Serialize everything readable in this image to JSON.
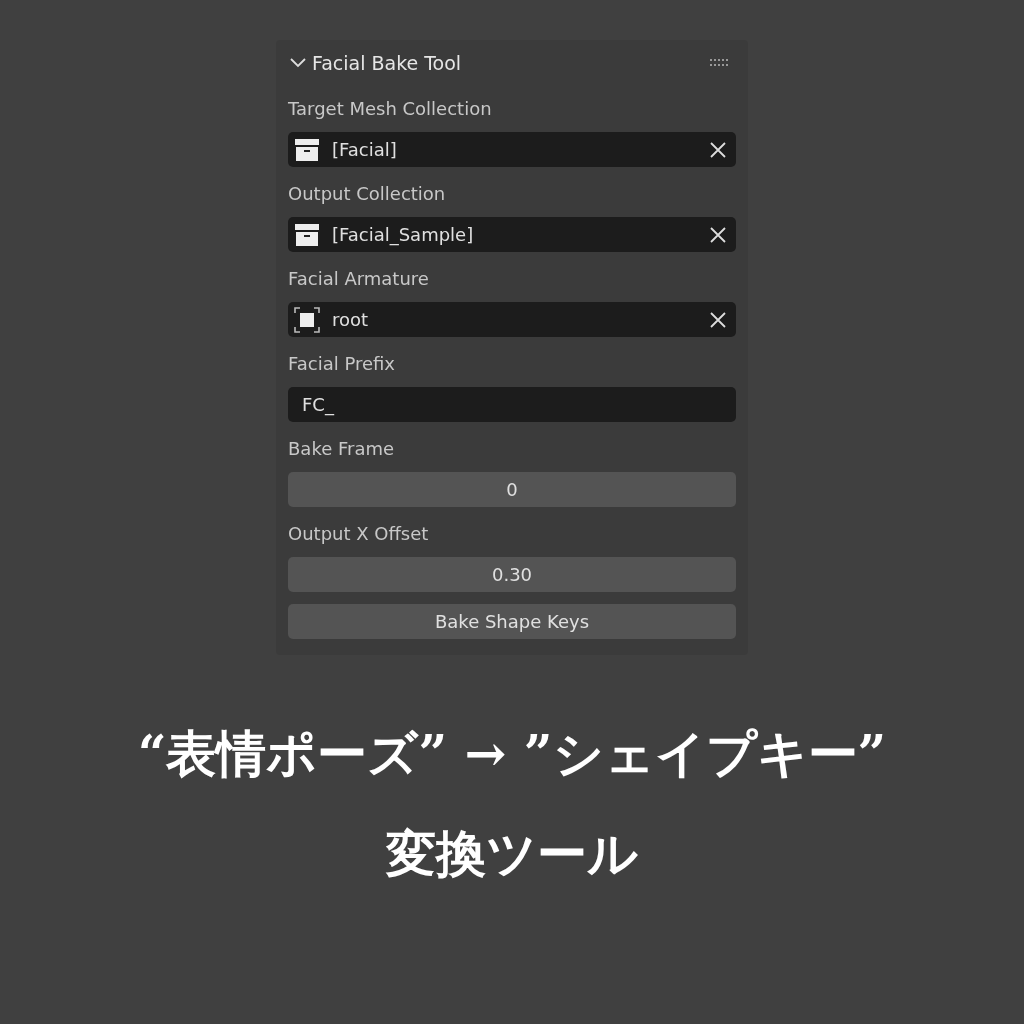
{
  "panel": {
    "title": "Facial Bake Tool",
    "expanded": true,
    "fields": [
      {
        "label": "Target Mesh Collection",
        "kind": "collection",
        "value": "[Facial]"
      },
      {
        "label": "Output Collection",
        "kind": "collection",
        "value": "[Facial_Sample]"
      },
      {
        "label": "Facial Armature",
        "kind": "armature",
        "value": "root"
      },
      {
        "label": "Facial Prefix",
        "kind": "text",
        "value": "FC_"
      },
      {
        "label": "Bake Frame",
        "kind": "number",
        "value": "0"
      },
      {
        "label": "Output X Offset",
        "kind": "number",
        "value": "0.30"
      }
    ],
    "button": "Bake Shape Keys"
  },
  "caption": [
    "“表情ポーズ” → ”シェイプキー”",
    "変換ツール"
  ]
}
